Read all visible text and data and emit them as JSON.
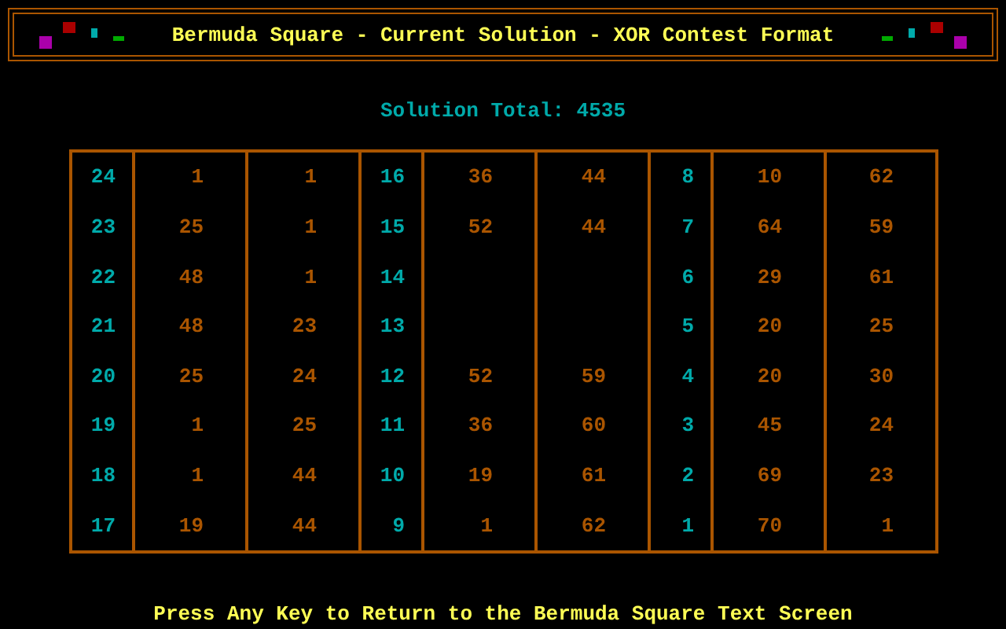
{
  "title": "Bermuda Square - Current Solution - XOR Contest Format",
  "solution_total": "Solution Total: 4535",
  "groups": [
    {
      "rows": [
        {
          "number": "24",
          "value_1": "1",
          "value_2": "1"
        },
        {
          "number": "23",
          "value_1": "25",
          "value_2": "1"
        },
        {
          "number": "22",
          "value_1": "48",
          "value_2": "1"
        },
        {
          "number": "21",
          "value_1": "48",
          "value_2": "23"
        },
        {
          "number": "20",
          "value_1": "25",
          "value_2": "24"
        },
        {
          "number": "19",
          "value_1": "1",
          "value_2": "25"
        },
        {
          "number": "18",
          "value_1": "1",
          "value_2": "44"
        },
        {
          "number": "17",
          "value_1": "19",
          "value_2": "44"
        }
      ]
    },
    {
      "rows": [
        {
          "number": "16",
          "value_1": "36",
          "value_2": "44"
        },
        {
          "number": "15",
          "value_1": "52",
          "value_2": "44"
        },
        {
          "number": "14"
        },
        {
          "number": "13"
        },
        {
          "number": "12",
          "value_1": "52",
          "value_2": "59"
        },
        {
          "number": "11",
          "value_1": "36",
          "value_2": "60"
        },
        {
          "number": "10",
          "value_1": "19",
          "value_2": "61"
        },
        {
          "number": "9",
          "value_1": "1",
          "value_2": "62"
        }
      ]
    },
    {
      "rows": [
        {
          "number": "8",
          "value_1": "10",
          "value_2": "62"
        },
        {
          "number": "7",
          "value_1": "64",
          "value_2": "59"
        },
        {
          "number": "6",
          "value_1": "29",
          "value_2": "61"
        },
        {
          "number": "5",
          "value_1": "20",
          "value_2": "25"
        },
        {
          "number": "4",
          "value_1": "20",
          "value_2": "30"
        },
        {
          "number": "3",
          "value_1": "45",
          "value_2": "24"
        },
        {
          "number": "2",
          "value_1": "69",
          "value_2": "23"
        },
        {
          "number": "1",
          "value_1": "70",
          "value_2": "1"
        }
      ]
    }
  ],
  "footer": "Press Any Key to Return to the Bermuda Square Text Screen"
}
